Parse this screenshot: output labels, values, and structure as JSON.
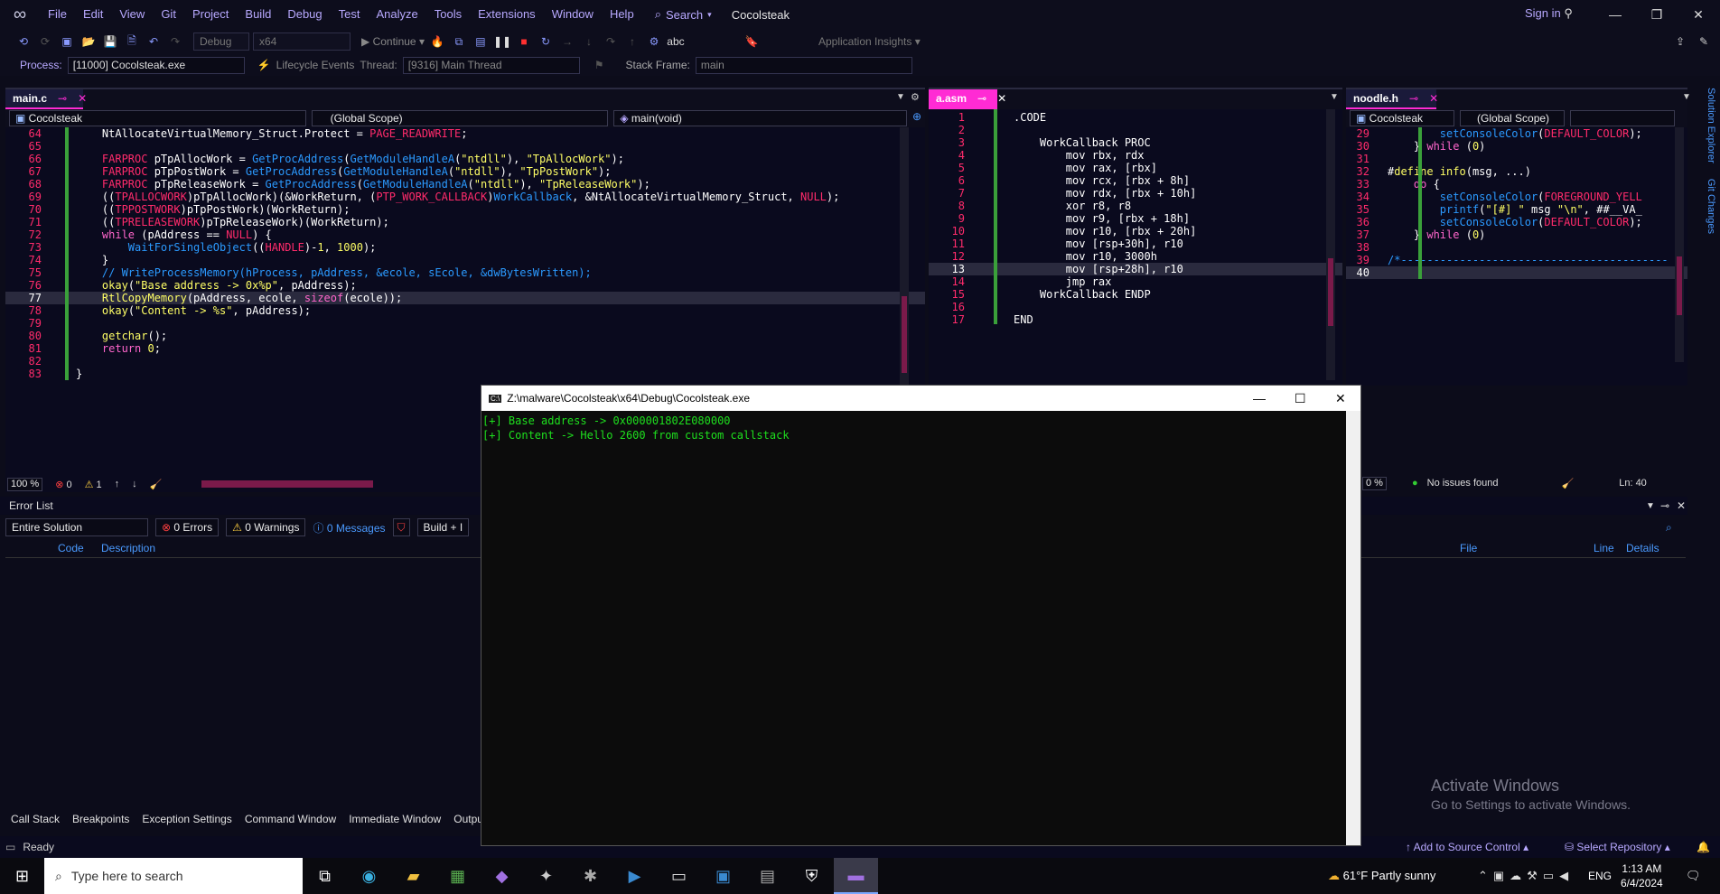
{
  "menubar": {
    "items": [
      "File",
      "Edit",
      "View",
      "Git",
      "Project",
      "Build",
      "Debug",
      "Test",
      "Analyze",
      "Tools",
      "Extensions",
      "Window",
      "Help"
    ],
    "search_label": "Search",
    "solution_name": "Cocolsteak",
    "signin_label": "Sign in"
  },
  "toolbar": {
    "config": "Debug",
    "platform": "x64",
    "continue_label": "Continue",
    "app_insights": "Application Insights"
  },
  "debug_bar": {
    "process_label": "Process:",
    "process_value": "[11000] Cocolsteak.exe",
    "lifecycle_label": "Lifecycle Events",
    "thread_label": "Thread:",
    "thread_value": "[9316] Main Thread",
    "stackframe_label": "Stack Frame:",
    "stackframe_value": "main"
  },
  "main_editor": {
    "tab": "main.c",
    "nav_project": "Cocolsteak",
    "nav_scope": "(Global Scope)",
    "nav_function": "main(void)",
    "lines": [
      {
        "n": "64",
        "text": "    NtAllocateVirtualMemory_Struct.Protect = PAGE_READWRITE;"
      },
      {
        "n": "65",
        "text": ""
      },
      {
        "n": "66",
        "text": "    FARPROC pTpAllocWork = GetProcAddress(GetModuleHandleA(\"ntdll\"), \"TpAllocWork\");"
      },
      {
        "n": "67",
        "text": "    FARPROC pTpPostWork = GetProcAddress(GetModuleHandleA(\"ntdll\"), \"TpPostWork\");"
      },
      {
        "n": "68",
        "text": "    FARPROC pTpReleaseWork = GetProcAddress(GetModuleHandleA(\"ntdll\"), \"TpReleaseWork\");"
      },
      {
        "n": "69",
        "text": "    ((TPALLOCWORK)pTpAllocWork)(&WorkReturn, (PTP_WORK_CALLBACK)WorkCallback, &NtAllocateVirtualMemory_Struct, NULL);"
      },
      {
        "n": "70",
        "text": "    ((TPPOSTWORK)pTpPostWork)(WorkReturn);"
      },
      {
        "n": "71",
        "text": "    ((TPRELEASEWORK)pTpReleaseWork)(WorkReturn);"
      },
      {
        "n": "72",
        "text": "    while (pAddress == NULL) {"
      },
      {
        "n": "73",
        "text": "        WaitForSingleObject((HANDLE)-1, 1000);"
      },
      {
        "n": "74",
        "text": "    }"
      },
      {
        "n": "75",
        "text": "    // WriteProcessMemory(hProcess, pAddress, &ecole, sEcole, &dwBytesWritten);"
      },
      {
        "n": "76",
        "text": "    okay(\"Base address -> 0x%p\", pAddress);"
      },
      {
        "n": "77",
        "text": "    RtlCopyMemory(pAddress, ecole, sizeof(ecole));"
      },
      {
        "n": "78",
        "text": "    okay(\"Content -> %s\", pAddress);"
      },
      {
        "n": "79",
        "text": ""
      },
      {
        "n": "80",
        "text": "    getchar();"
      },
      {
        "n": "81",
        "text": "    return 0;"
      },
      {
        "n": "82",
        "text": ""
      },
      {
        "n": "83",
        "text": "}"
      }
    ],
    "zoom": "100 %",
    "errors": "0",
    "warnings": "1"
  },
  "asm_editor": {
    "tab": "a.asm",
    "lines": [
      {
        "n": "1",
        "text": ".CODE"
      },
      {
        "n": "2",
        "text": ""
      },
      {
        "n": "3",
        "text": "    WorkCallback PROC"
      },
      {
        "n": "4",
        "text": "        mov rbx, rdx"
      },
      {
        "n": "5",
        "text": "        mov rax, [rbx]"
      },
      {
        "n": "6",
        "text": "        mov rcx, [rbx + 8h]"
      },
      {
        "n": "7",
        "text": "        mov rdx, [rbx + 10h]"
      },
      {
        "n": "8",
        "text": "        xor r8, r8"
      },
      {
        "n": "9",
        "text": "        mov r9, [rbx + 18h]"
      },
      {
        "n": "10",
        "text": "        mov r10, [rbx + 20h]"
      },
      {
        "n": "11",
        "text": "        mov [rsp+30h], r10"
      },
      {
        "n": "12",
        "text": "        mov r10, 3000h"
      },
      {
        "n": "13",
        "text": "        mov [rsp+28h], r10"
      },
      {
        "n": "14",
        "text": "        jmp rax"
      },
      {
        "n": "15",
        "text": "    WorkCallback ENDP"
      },
      {
        "n": "16",
        "text": ""
      },
      {
        "n": "17",
        "text": "END"
      }
    ]
  },
  "header_editor": {
    "tab": "noodle.h",
    "nav_project": "Cocolsteak",
    "nav_scope": "(Global Scope)",
    "lines": [
      {
        "n": "29",
        "text": "        setConsoleColor(DEFAULT_COLOR);"
      },
      {
        "n": "30",
        "text": "    } while (0)"
      },
      {
        "n": "31",
        "text": ""
      },
      {
        "n": "32",
        "text": "#define info(msg, ...)"
      },
      {
        "n": "33",
        "text": "    do {"
      },
      {
        "n": "34",
        "text": "        setConsoleColor(FOREGROUND_YELL"
      },
      {
        "n": "35",
        "text": "        printf(\"[#] \" msg \"\\n\", ##__VA_"
      },
      {
        "n": "36",
        "text": "        setConsoleColor(DEFAULT_COLOR);"
      },
      {
        "n": "37",
        "text": "    } while (0)"
      },
      {
        "n": "38",
        "text": ""
      },
      {
        "n": "39",
        "text": "/*-----------------------------------------"
      },
      {
        "n": "40",
        "text": ""
      }
    ],
    "zoom": "0 %",
    "issues": "No issues found",
    "line_col": "Ln: 40"
  },
  "console": {
    "title": "Z:\\malware\\Cocolsteak\\x64\\Debug\\Cocolsteak.exe",
    "lines": [
      "[+] Base address -> 0x000001802E080000",
      "[+] Content -> Hello 2600 from custom callstack"
    ]
  },
  "error_list": {
    "title": "Error List",
    "scope": "Entire Solution",
    "errors": "0 Errors",
    "warnings": "0 Warnings",
    "messages": "0 Messages",
    "build": "Build + I",
    "columns": {
      "code": "Code",
      "description": "Description",
      "file": "File",
      "line": "Line",
      "details": "Details"
    }
  },
  "bottom_tabs": [
    "Call Stack",
    "Breakpoints",
    "Exception Settings",
    "Command Window",
    "Immediate Window",
    "Output"
  ],
  "status": {
    "ready": "Ready",
    "source_control": "Add to Source Control",
    "repository": "Select Repository"
  },
  "activate": {
    "title": "Activate Windows",
    "subtitle": "Go to Settings to activate Windows."
  },
  "side_tabs": [
    "Solution Explorer",
    "Git Changes"
  ],
  "taskbar": {
    "search_placeholder": "Type here to search",
    "weather": "61°F  Partly sunny",
    "lang": "ENG",
    "time": "1:13 AM",
    "date": "6/4/2024"
  }
}
